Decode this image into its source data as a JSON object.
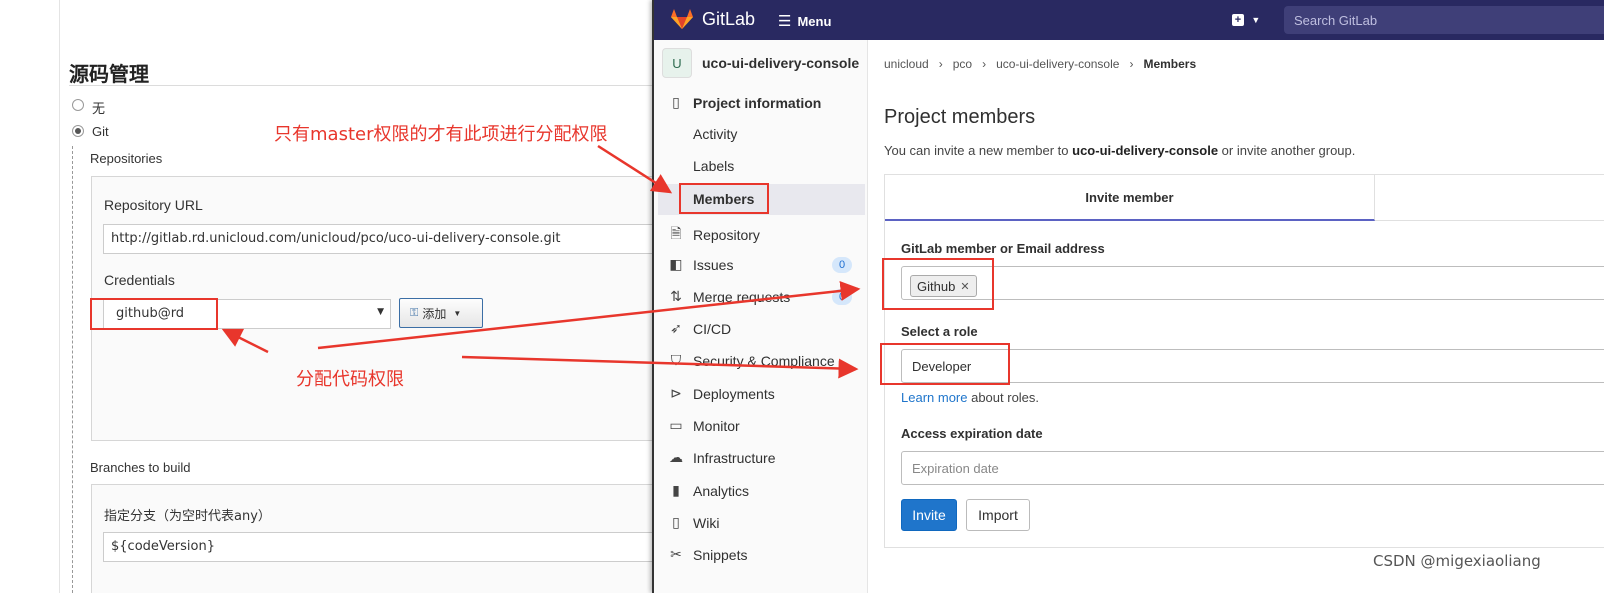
{
  "jenkins": {
    "section_title": "源码管理",
    "scm_options": [
      {
        "label": "无",
        "selected": false
      },
      {
        "label": "Git",
        "selected": true
      }
    ],
    "repositories_label": "Repositories",
    "repository_url_label": "Repository URL",
    "repository_url_value": "http://gitlab.rd.unicloud.com/unicloud/pco/uco-ui-delivery-console.git",
    "credentials_label": "Credentials",
    "credentials_value": "github@rd",
    "add_button_label": "添加",
    "branches_label": "Branches to build",
    "branch_field_label": "指定分支（为空时代表any）",
    "branch_value": "${codeVersion}"
  },
  "gitlab": {
    "brand": "GitLab",
    "menu_label": "Menu",
    "search_placeholder": "Search GitLab",
    "project_avatar": "U",
    "project_name": "uco-ui-delivery-console",
    "sidebar": {
      "project_information": "Project information",
      "sub_items": [
        "Activity",
        "Labels",
        "Members"
      ],
      "repository": "Repository",
      "issues": "Issues",
      "issues_count": "0",
      "merge_requests": "Merge requests",
      "merge_requests_count": "0",
      "cicd": "CI/CD",
      "security": "Security & Compliance",
      "deployments": "Deployments",
      "monitor": "Monitor",
      "infrastructure": "Infrastructure",
      "analytics": "Analytics",
      "wiki": "Wiki",
      "snippets": "Snippets"
    },
    "breadcrumb": [
      "unicloud",
      "pco",
      "uco-ui-delivery-console",
      "Members"
    ],
    "page_title": "Project members",
    "desc_prefix": "You can invite a new member to ",
    "desc_project": "uco-ui-delivery-console",
    "desc_suffix": " or invite another group.",
    "tab_invite": "Invite member",
    "member_label": "GitLab member or Email address",
    "member_token": "Github",
    "role_label": "Select a role",
    "role_value": "Developer",
    "learn_more": "Learn more",
    "about_roles": " about roles.",
    "expiration_label": "Access expiration date",
    "expiration_placeholder": "Expiration date",
    "invite_button": "Invite",
    "import_button": "Import"
  },
  "annotations": {
    "top_note": "只有master权限的才有此项进行分配权限",
    "bottom_note": "分配代码权限",
    "color": "#e8362c"
  },
  "watermark": "CSDN @migexiaoliang"
}
